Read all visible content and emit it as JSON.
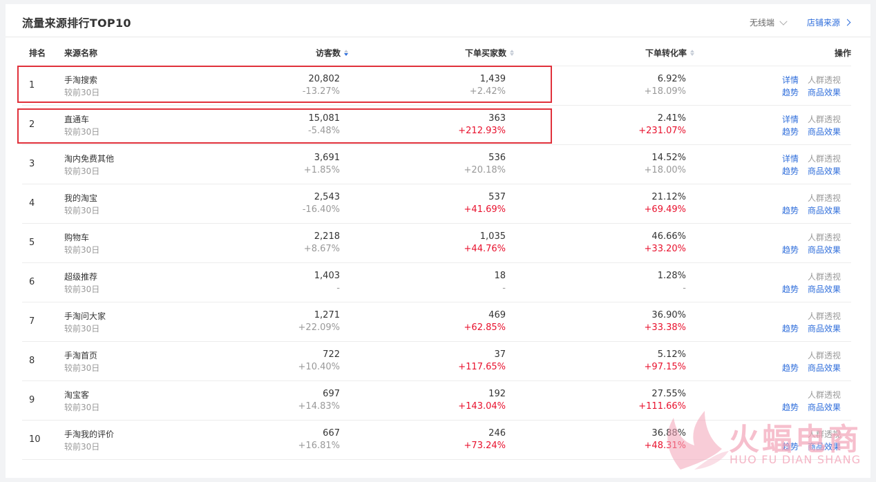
{
  "card": {
    "title": "流量来源排行TOP10",
    "device": "无线端",
    "shop_link": "店铺来源"
  },
  "columns": {
    "rank": "排名",
    "source": "来源名称",
    "visitors": "访客数",
    "buyers": "下单买家数",
    "conversion": "下单转化率",
    "actions": "操作"
  },
  "action_labels": {
    "detail": "详情",
    "crowd": "人群透视",
    "trend": "趋势",
    "goods": "商品效果"
  },
  "compare_label": "较前30日",
  "rows": [
    {
      "rank": "1",
      "name": "手淘搜索",
      "visitors": "20,802",
      "visitors_delta": "-13.27%",
      "buyers": "1,439",
      "buyers_delta": "+2.42%",
      "buyers_up": false,
      "conv": "6.92%",
      "conv_delta": "+18.09%",
      "conv_up": false,
      "has_detail": true
    },
    {
      "rank": "2",
      "name": "直通车",
      "visitors": "15,081",
      "visitors_delta": "-5.48%",
      "buyers": "363",
      "buyers_delta": "+212.93%",
      "buyers_up": true,
      "conv": "2.41%",
      "conv_delta": "+231.07%",
      "conv_up": true,
      "has_detail": true
    },
    {
      "rank": "3",
      "name": "淘内免费其他",
      "visitors": "3,691",
      "visitors_delta": "+1.85%",
      "buyers": "536",
      "buyers_delta": "+20.18%",
      "buyers_up": false,
      "conv": "14.52%",
      "conv_delta": "+18.00%",
      "conv_up": false,
      "has_detail": true
    },
    {
      "rank": "4",
      "name": "我的淘宝",
      "visitors": "2,543",
      "visitors_delta": "-16.40%",
      "buyers": "537",
      "buyers_delta": "+41.69%",
      "buyers_up": true,
      "conv": "21.12%",
      "conv_delta": "+69.49%",
      "conv_up": true,
      "has_detail": false
    },
    {
      "rank": "5",
      "name": "购物车",
      "visitors": "2,218",
      "visitors_delta": "+8.67%",
      "buyers": "1,035",
      "buyers_delta": "+44.76%",
      "buyers_up": true,
      "conv": "46.66%",
      "conv_delta": "+33.20%",
      "conv_up": true,
      "has_detail": false
    },
    {
      "rank": "6",
      "name": "超级推荐",
      "visitors": "1,403",
      "visitors_delta": "-",
      "buyers": "18",
      "buyers_delta": "-",
      "buyers_up": false,
      "conv": "1.28%",
      "conv_delta": "-",
      "conv_up": false,
      "has_detail": false
    },
    {
      "rank": "7",
      "name": "手淘问大家",
      "visitors": "1,271",
      "visitors_delta": "+22.09%",
      "buyers": "469",
      "buyers_delta": "+62.85%",
      "buyers_up": true,
      "conv": "36.90%",
      "conv_delta": "+33.38%",
      "conv_up": true,
      "has_detail": false
    },
    {
      "rank": "8",
      "name": "手淘首页",
      "visitors": "722",
      "visitors_delta": "+10.40%",
      "buyers": "37",
      "buyers_delta": "+117.65%",
      "buyers_up": true,
      "conv": "5.12%",
      "conv_delta": "+97.15%",
      "conv_up": true,
      "has_detail": false
    },
    {
      "rank": "9",
      "name": "淘宝客",
      "visitors": "697",
      "visitors_delta": "+14.83%",
      "buyers": "192",
      "buyers_delta": "+143.04%",
      "buyers_up": true,
      "conv": "27.55%",
      "conv_delta": "+111.66%",
      "conv_up": true,
      "has_detail": false
    },
    {
      "rank": "10",
      "name": "手淘我的评价",
      "visitors": "667",
      "visitors_delta": "+16.81%",
      "buyers": "246",
      "buyers_delta": "+73.24%",
      "buyers_up": true,
      "conv": "36.88%",
      "conv_delta": "+48.31%",
      "conv_up": true,
      "has_detail": false
    }
  ],
  "watermark": {
    "cn": "火蝠电商",
    "en": "HUO FU DIAN SHANG"
  },
  "colors": {
    "accent": "#2f6edb",
    "increase": "#e8112d",
    "highlight_box": "#e0303a"
  }
}
